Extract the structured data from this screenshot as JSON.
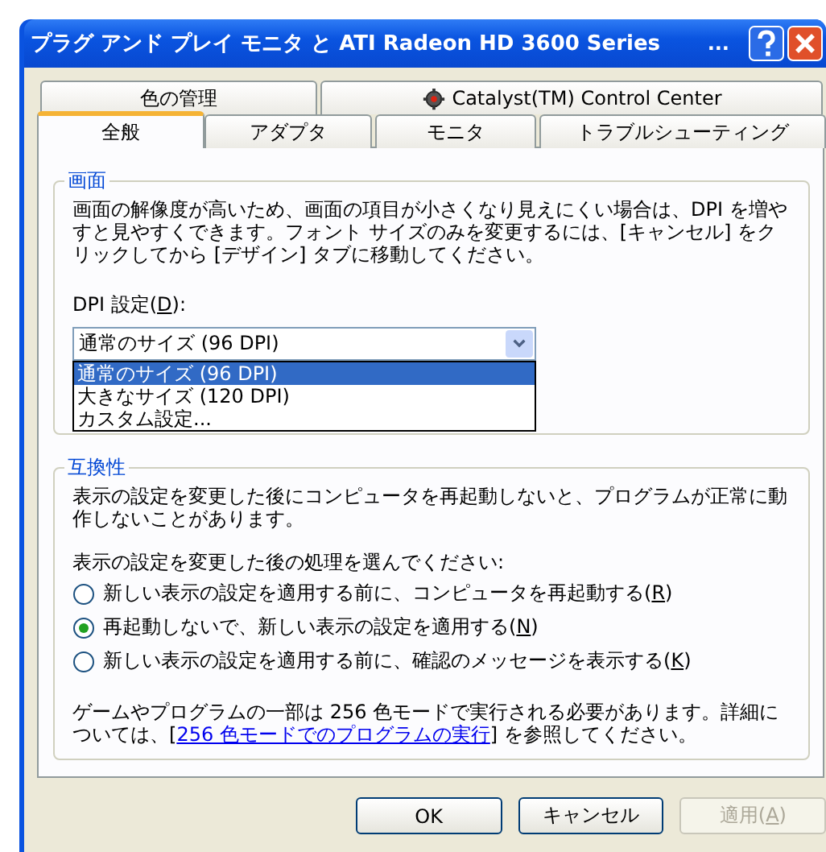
{
  "window": {
    "title": "プラグ アンド プレイ モニタ と ATI Radeon HD 3600 Series",
    "title_ellipsis": "..."
  },
  "tab_rows": [
    [
      {
        "label": "色の管理",
        "selected": false,
        "kind": "plain"
      },
      {
        "label": "Catalyst(TM) Control Center",
        "selected": false,
        "kind": "icon"
      }
    ],
    [
      {
        "label": "全般",
        "selected": true,
        "kind": "plain"
      },
      {
        "label": "アダプタ",
        "selected": false,
        "kind": "plain"
      },
      {
        "label": "モニタ",
        "selected": false,
        "kind": "plain"
      },
      {
        "label": "トラブルシューティング",
        "selected": false,
        "kind": "plain"
      }
    ]
  ],
  "display_group": {
    "title": "画面",
    "description": "画面の解像度が高いため、画面の項目が小さくなり見えにくい場合は、DPI を増やすと見やすくできます。フォント サイズのみを変更するには、[キャンセル] をクリックしてから [デザイン] タブに移動してください。",
    "dpi_label": {
      "before": "DPI 設定(",
      "accel": "D",
      "after": "):"
    },
    "dpi_value": "通常のサイズ (96 DPI)",
    "dpi_options": [
      {
        "label": "通常のサイズ (96 DPI)",
        "selected": true
      },
      {
        "label": "大きなサイズ (120 DPI)",
        "selected": false
      },
      {
        "label": "カスタム設定...",
        "selected": false
      }
    ]
  },
  "compat_group": {
    "title": "互換性",
    "warning": "表示の設定を変更した後にコンピュータを再起動しないと、プログラムが正常に動作しないことがあります。",
    "prompt": "表示の設定を変更した後の処理を選んでください:",
    "options": [
      {
        "before": "新しい表示の設定を適用する前に、コンピュータを再起動する(",
        "accel": "R",
        "after": ")",
        "selected": false
      },
      {
        "before": "再起動しないで、新しい表示の設定を適用する(",
        "accel": "N",
        "after": ")",
        "selected": true
      },
      {
        "before": "新しい表示の設定を適用する前に、確認のメッセージを表示する(",
        "accel": "K",
        "after": ")",
        "selected": false
      }
    ],
    "note": {
      "before": "ゲームやプログラムの一部は 256 色モードで実行される必要があります。詳細については、[",
      "link": "256 色モードでのプログラムの実行",
      "after": "] を参照してください。"
    }
  },
  "buttons": [
    {
      "before": "OK",
      "disabled": false
    },
    {
      "before": "キャンセル",
      "disabled": false
    },
    {
      "before": "適用(",
      "accel": "A",
      "after": ")",
      "disabled": true
    }
  ]
}
